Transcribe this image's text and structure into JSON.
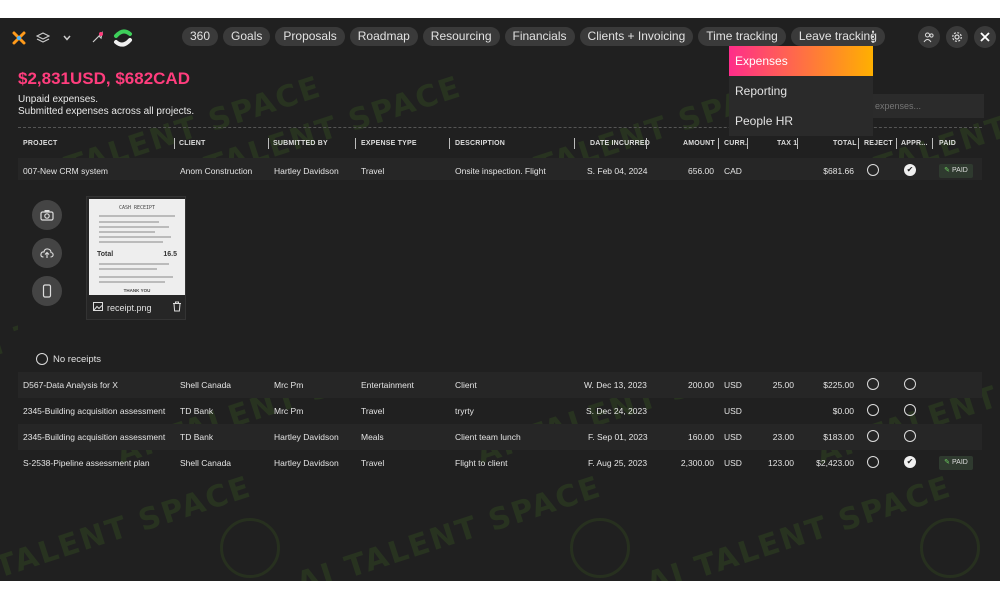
{
  "nav_tabs": [
    "360",
    "Goals",
    "Proposals",
    "Roadmap",
    "Resourcing",
    "Financials",
    "Clients + Invoicing",
    "Time tracking",
    "Leave tracking"
  ],
  "menu_items": [
    "Expenses",
    "Reporting",
    "People HR"
  ],
  "summary": {
    "title": "$2,831USD, $682CAD",
    "line1": "Unpaid expenses.",
    "line2": "Submitted expenses across all projects."
  },
  "search": {
    "placeholder": "expenses..."
  },
  "columns": [
    "PROJECT",
    "CLIENT",
    "SUBMITTED BY",
    "EXPENSE TYPE",
    "DESCRIPTION",
    "DATE INCURRED",
    "AMOUNT",
    "CURR.",
    "TAX 1",
    "TOTAL",
    "REJECT",
    "APPR...",
    "PAID"
  ],
  "rows": [
    {
      "project": "007-New CRM system",
      "client": "Anom Construction",
      "submitted_by": "Hartley Davidson",
      "type": "Travel",
      "description": "Onsite inspection. Flight",
      "date": "S. Feb 04, 2024",
      "amount": "656.00",
      "curr": "CAD",
      "tax": "",
      "total": "$681.66",
      "approved": true,
      "paid": "PAID"
    },
    {
      "project": "D567-Data Analysis for X",
      "client": "Shell Canada",
      "submitted_by": "Mrc Pm",
      "type": "Entertainment",
      "description": "Client",
      "date": "W. Dec 13, 2023",
      "amount": "200.00",
      "curr": "USD",
      "tax": "25.00",
      "total": "$225.00",
      "approved": false,
      "paid": ""
    },
    {
      "project": "2345-Building acquisition assessment",
      "client": "TD Bank",
      "submitted_by": "Mrc Pm",
      "type": "Travel",
      "description": "tryrty",
      "date": "S. Dec 24, 2023",
      "amount": "",
      "curr": "USD",
      "tax": "",
      "total": "$0.00",
      "approved": false,
      "paid": ""
    },
    {
      "project": "2345-Building acquisition assessment",
      "client": "TD Bank",
      "submitted_by": "Hartley Davidson",
      "type": "Meals",
      "description": "Client team lunch",
      "date": "F. Sep 01, 2023",
      "amount": "160.00",
      "curr": "USD",
      "tax": "23.00",
      "total": "$183.00",
      "approved": false,
      "paid": ""
    },
    {
      "project": "S-2538-Pipeline assessment plan",
      "client": "Shell Canada",
      "submitted_by": "Hartley Davidson",
      "type": "Travel",
      "description": "Flight to client",
      "date": "F. Aug 25, 2023",
      "amount": "2,300.00",
      "curr": "USD",
      "tax": "123.00",
      "total": "$2,423.00",
      "approved": true,
      "paid": "PAID"
    }
  ],
  "receipt": {
    "filename": "receipt.png",
    "doc_title": "CASH RECEIPT",
    "total_label": "Total",
    "total_value": "16.5",
    "thanks": "THANK YOU"
  },
  "no_receipts_label": "No receipts",
  "watermark": "AI TALENT SPACE",
  "colors": {
    "accent": "#ff3d7d",
    "menu_gradient_start": "#ff2d8a",
    "menu_gradient_end": "#ffb000",
    "paid_leaf": "#6fcf60"
  }
}
